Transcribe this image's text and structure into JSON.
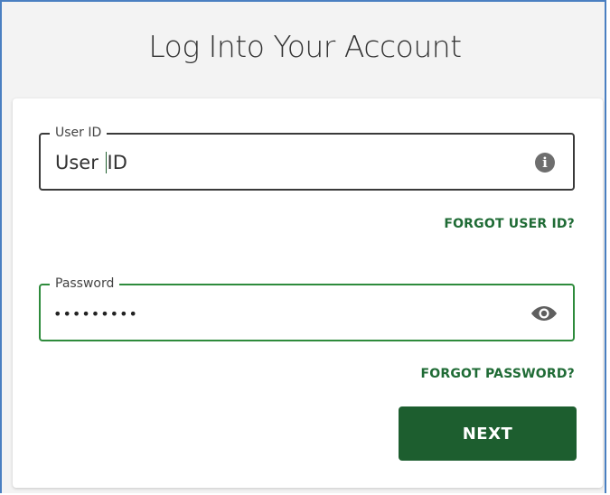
{
  "page": {
    "title": "Log Into Your Account"
  },
  "login": {
    "userid": {
      "label": "User ID",
      "value_before_caret": "User ",
      "value_after_caret": "ID",
      "icon": "info-icon"
    },
    "forgot_userid": "FORGOT USER ID?",
    "password": {
      "label": "Password",
      "value": "•••••••••",
      "icon": "eye-icon"
    },
    "forgot_password": "FORGOT PASSWORD?",
    "next_label": "NEXT"
  },
  "colors": {
    "accent_green": "#1d5e2f",
    "focus_border": "#2e8b3c",
    "link_green": "#1f6b35",
    "frame_blue": "#4a7fc1"
  }
}
